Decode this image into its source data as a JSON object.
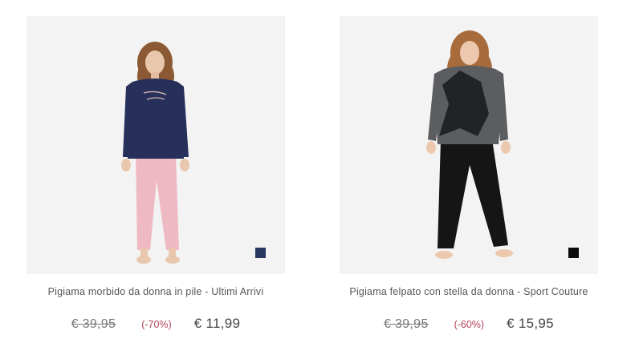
{
  "products": [
    {
      "title": "Pigiama morbido da donna in pile - Ultimi Arrivi",
      "old_price": "€ 39,95",
      "discount": "(-70%)",
      "new_price": "€ 11,99",
      "swatch_color": "#27365e",
      "top_color": "#26305a",
      "bottom_color": "#efb9c4"
    },
    {
      "title": "Pigiama felpato con stella da donna - Sport Couture",
      "old_price": "€ 39,95",
      "discount": "(-60%)",
      "new_price": "€ 15,95",
      "swatch_color": "#0b0b0b",
      "top_color": "#5b5d60",
      "bottom_color": "#151515"
    }
  ]
}
